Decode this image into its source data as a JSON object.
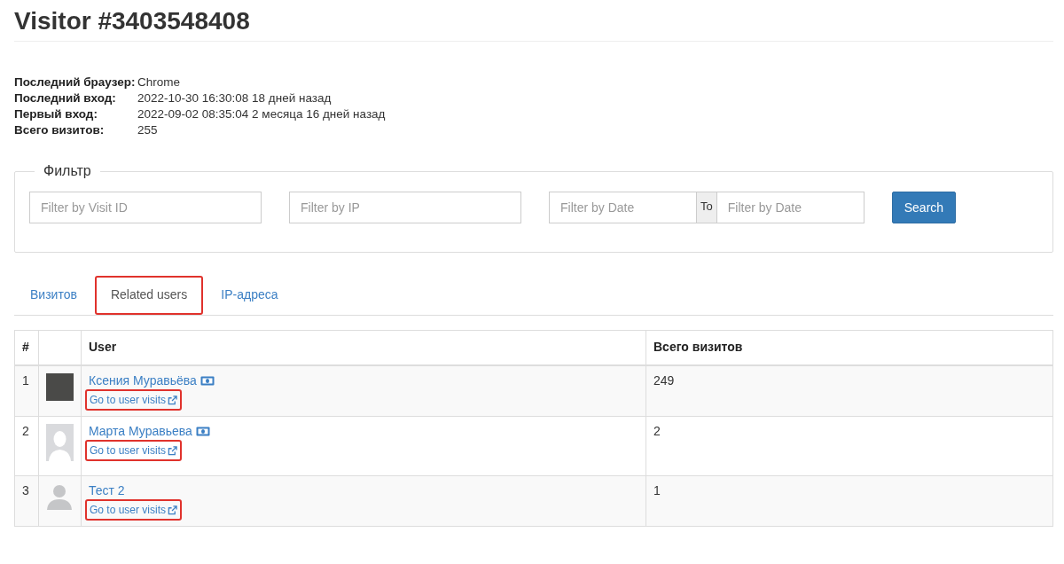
{
  "title": "Visitor #3403548408",
  "info": [
    {
      "label": "Последний браузер:",
      "value": "Chrome"
    },
    {
      "label": "Последний вход:",
      "value": "2022-10-30 16:30:08 18 дней назад"
    },
    {
      "label": "Первый вход:",
      "value": "2022-09-02 08:35:04 2 месяца 16 дней назад"
    },
    {
      "label": "Всего визитов:",
      "value": "255"
    }
  ],
  "filter": {
    "legend": "Фильтр",
    "visit_id": {
      "placeholder": "Filter by Visit ID"
    },
    "ip": {
      "placeholder": "Filter by IP"
    },
    "date_from": {
      "placeholder": "Filter by Date"
    },
    "to_label": "To",
    "date_to": {
      "placeholder": "Filter by Date"
    },
    "button": "Search"
  },
  "tabs": [
    {
      "label": "Визитов",
      "selected": false,
      "highlighted": false
    },
    {
      "label": "Related users",
      "selected": true,
      "highlighted": true
    },
    {
      "label": "IP-адреса",
      "selected": false,
      "highlighted": false
    }
  ],
  "table": {
    "columns": [
      "#",
      "User",
      "Всего визитов"
    ],
    "rows": [
      {
        "index": "1",
        "avatar": {
          "kind": "photo"
        },
        "name": "Ксения Муравьёва",
        "badge": true,
        "link": "Go to user visits",
        "link_highlighted": true,
        "visits": "249"
      },
      {
        "index": "2",
        "avatar": {
          "kind": "placeholder"
        },
        "name": "Марта Муравьева",
        "badge": true,
        "link": "Go to user visits",
        "link_highlighted": true,
        "visits": "2"
      },
      {
        "index": "3",
        "avatar": {
          "kind": "silhouette"
        },
        "name": "Тест 2",
        "badge": false,
        "link": "Go to user visits",
        "link_highlighted": true,
        "visits": "1"
      }
    ]
  }
}
